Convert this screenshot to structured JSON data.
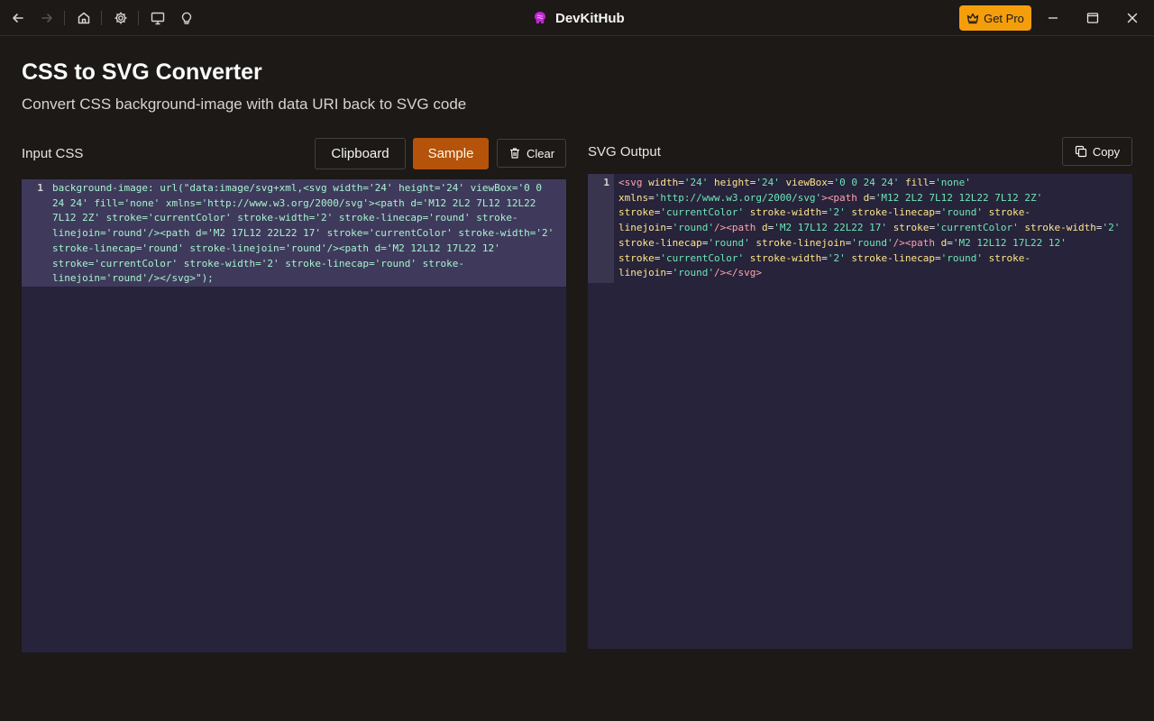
{
  "app": {
    "title": "DevKitHub",
    "get_pro_label": "Get Pro"
  },
  "icons": {
    "back": "arrow-left-icon",
    "forward": "arrow-right-icon",
    "home": "home-icon",
    "settings": "gear-icon",
    "monitor": "monitor-icon",
    "idea": "lightbulb-icon",
    "logo": "brain-logo-icon",
    "crown": "crown-icon",
    "trash": "trash-icon",
    "copy": "copy-icon"
  },
  "colors": {
    "accent": "#b45309",
    "pro": "#f59e0b",
    "background": "#1c1917",
    "editor_bg": "#27233a"
  },
  "page": {
    "title": "CSS to SVG Converter",
    "subtitle": "Convert CSS background-image with data URI back to SVG code"
  },
  "input": {
    "label": "Input CSS",
    "clipboard_label": "Clipboard",
    "sample_label": "Sample",
    "clear_label": "Clear",
    "line_number": "1",
    "code": "background-image: url(\"data:image/svg+xml,<svg width='24' height='24' viewBox='0 0 24 24' fill='none' xmlns='http://www.w3.org/2000/svg'><path d='M12 2L2 7L12 12L22 7L12 2Z' stroke='currentColor' stroke-width='2' stroke-linecap='round' stroke-linejoin='round'/><path d='M2 17L12 22L22 17' stroke='currentColor' stroke-width='2' stroke-linecap='round' stroke-linejoin='round'/><path d='M2 12L12 17L22 12' stroke='currentColor' stroke-width='2' stroke-linecap='round' stroke-linejoin='round'/></svg>\");"
  },
  "output": {
    "label": "SVG Output",
    "copy_label": "Copy",
    "line_number": "1",
    "code": "<svg width='24' height='24' viewBox='0 0 24 24' fill='none' xmlns='http://www.w3.org/2000/svg'><path d='M12 2L2 7L12 12L22 7L12 2Z' stroke='currentColor' stroke-width='2' stroke-linecap='round' stroke-linejoin='round'/><path d='M2 17L12 22L22 17' stroke='currentColor' stroke-width='2' stroke-linecap='round' stroke-linejoin='round'/><path d='M2 12L12 17L22 12' stroke='currentColor' stroke-width='2' stroke-linecap='round' stroke-linejoin='round'/></svg>"
  }
}
